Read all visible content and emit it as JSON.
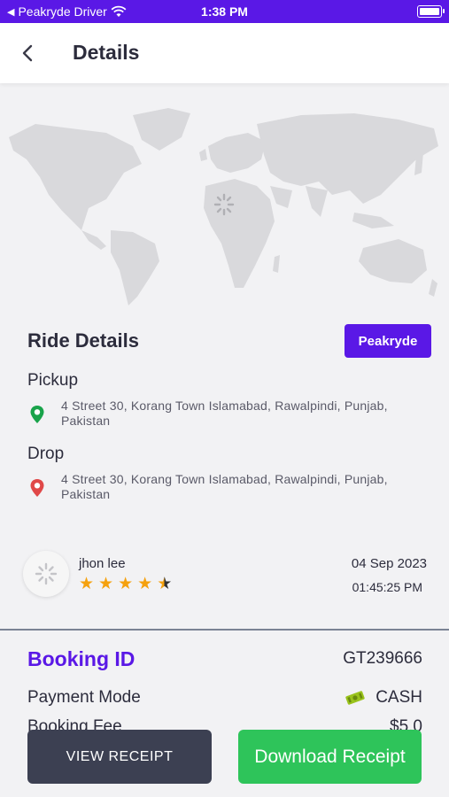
{
  "status_bar": {
    "back_app": "Peakryde Driver",
    "time": "1:38 PM"
  },
  "header": {
    "title": "Details"
  },
  "ride": {
    "section_title": "Ride Details",
    "brand": "Peakryde",
    "pickup_label": "Pickup",
    "pickup_address": "4 Street 30, Korang Town Islamabad, Rawalpindi, Punjab, Pakistan",
    "drop_label": "Drop",
    "drop_address": "4 Street 30, Korang Town Islamabad, Rawalpindi, Punjab, Pakistan"
  },
  "driver": {
    "name": "jhon lee",
    "rating": 4.5,
    "rating_max": 5,
    "date": "04 Sep 2023",
    "time": "01:45:25 PM"
  },
  "booking": {
    "id_label": "Booking ID",
    "id_value": "GT239666",
    "payment_label": "Payment Mode",
    "payment_value": "CASH",
    "fee_label": "Booking Fee",
    "fee_value": "$5.0"
  },
  "buttons": {
    "view_receipt": "VIEW RECEIPT",
    "download_receipt": "Download Receipt"
  },
  "colors": {
    "accent": "#5a18e6",
    "download_green": "#2ec45a",
    "view_dark": "#3c4052",
    "star": "#f5a10e"
  }
}
